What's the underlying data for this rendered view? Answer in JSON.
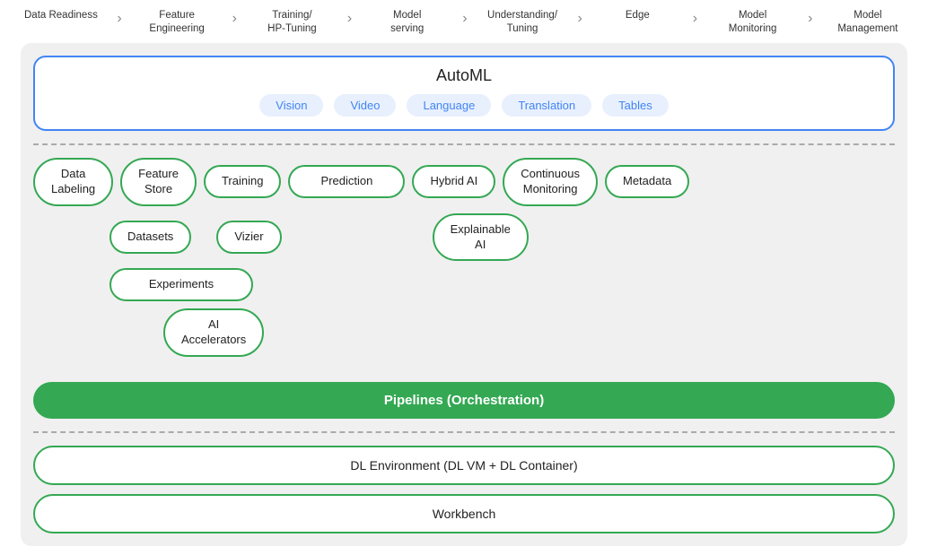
{
  "nav": {
    "items": [
      {
        "label": "Data\nReadiness",
        "id": "data-readiness"
      },
      {
        "label": "Feature\nEngineering",
        "id": "feature-engineering"
      },
      {
        "label": "Training/\nHP-Tuning",
        "id": "training-hp-tuning"
      },
      {
        "label": "Model\nserving",
        "id": "model-serving"
      },
      {
        "label": "Understanding/\nTuning",
        "id": "understanding-tuning"
      },
      {
        "label": "Edge",
        "id": "edge"
      },
      {
        "label": "Model\nMonitoring",
        "id": "model-monitoring"
      },
      {
        "label": "Model\nManagement",
        "id": "model-management"
      }
    ]
  },
  "automl": {
    "title": "AutoML",
    "pills": [
      "Vision",
      "Video",
      "Language",
      "Translation",
      "Tables"
    ]
  },
  "components": {
    "row1": [
      {
        "label": "Data\nLabeling"
      },
      {
        "label": "Feature\nStore"
      },
      {
        "label": "Training"
      },
      {
        "label": "Prediction"
      },
      {
        "label": "Hybrid AI"
      },
      {
        "label": "Continuous\nMonitoring"
      },
      {
        "label": "Metadata"
      }
    ],
    "row2": [
      {
        "label": "Datasets"
      },
      {
        "label": "Vizier"
      },
      {
        "label": "Explainable\nAI"
      }
    ],
    "row3": [
      {
        "label": "Experiments"
      }
    ],
    "row4": [
      {
        "label": "AI\nAccelerators"
      }
    ]
  },
  "pipelines": {
    "label": "Pipelines (Orchestration)"
  },
  "bottom": {
    "items": [
      {
        "label": "DL Environment (DL VM + DL Container)"
      },
      {
        "label": "Workbench"
      }
    ]
  }
}
